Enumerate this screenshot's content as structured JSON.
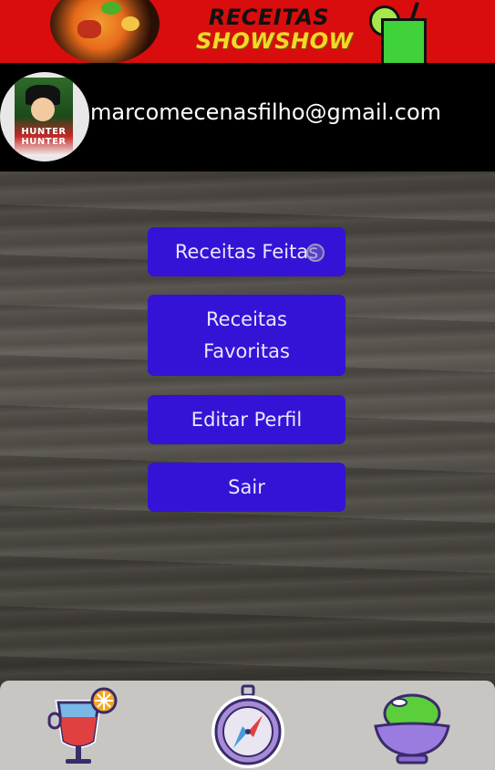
{
  "header": {
    "title_line1": "RECEITAS",
    "title_line2": "SHOWSHOW"
  },
  "profile": {
    "email": "marcomecenasfilho@gmail.com",
    "avatar_text": "HUNTER HUNTER"
  },
  "menu": {
    "made_label": "Receitas Feitas",
    "favorites_label": "Receitas Favoritas",
    "edit_label": "Editar Perfil",
    "exit_label": "Sair"
  },
  "bottom_nav": {
    "items": [
      {
        "icon": "drink-icon"
      },
      {
        "icon": "compass-icon"
      },
      {
        "icon": "food-bowl-icon"
      }
    ]
  },
  "colors": {
    "header_bg": "#d90d0d",
    "button_bg": "#3413d6",
    "profile_bg": "#000000",
    "nav_bg": "#c8c6c3"
  }
}
